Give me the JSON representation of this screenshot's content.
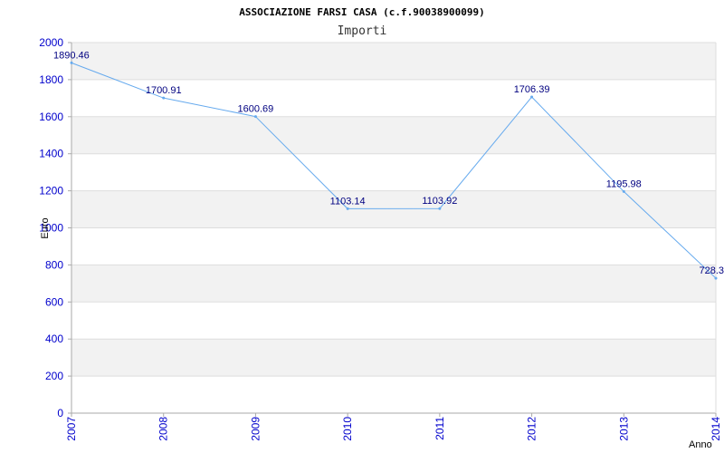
{
  "chart_data": {
    "type": "line",
    "title": "ASSOCIAZIONE FARSI CASA (c.f.90038900099)",
    "subtitle": "Importi",
    "xlabel": "Anno",
    "ylabel": "Euro",
    "x": [
      "2007",
      "2008",
      "2009",
      "2010",
      "2011",
      "2012",
      "2013",
      "2014"
    ],
    "series": [
      {
        "values": [
          1890.46,
          1700.91,
          1600.69,
          1103.14,
          1103.92,
          1706.39,
          1195.98,
          728.3
        ]
      }
    ],
    "data_labels": [
      "1890.46",
      "1700.91",
      "1600.69",
      "1103.14",
      "1103.92",
      "1706.39",
      "1195.98",
      "728.3"
    ],
    "ylim": [
      0,
      2000
    ],
    "yticks": [
      0,
      200,
      400,
      600,
      800,
      1000,
      1200,
      1400,
      1600,
      1800,
      2000
    ],
    "grid": true,
    "colors": {
      "line": "#66aaee",
      "band": "#f2f2f2",
      "gridline": "#dddddd",
      "tick_text": "#0000cc",
      "label_text": "#000080",
      "axis": "#aaaaaa"
    }
  }
}
